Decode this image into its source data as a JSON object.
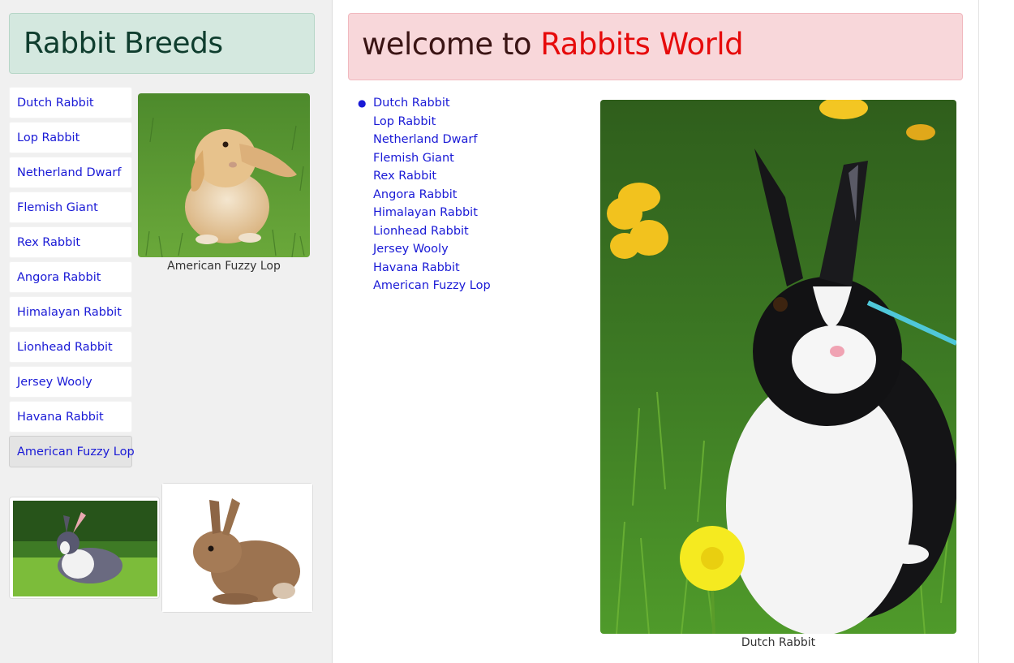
{
  "sidebar": {
    "title": "Rabbit Breeds",
    "items": [
      {
        "label": "Dutch Rabbit"
      },
      {
        "label": "Lop Rabbit"
      },
      {
        "label": "Netherland Dwarf"
      },
      {
        "label": "Flemish Giant"
      },
      {
        "label": "Rex Rabbit"
      },
      {
        "label": "Angora Rabbit"
      },
      {
        "label": "Himalayan Rabbit"
      },
      {
        "label": "Lionhead Rabbit"
      },
      {
        "label": "Jersey Wooly"
      },
      {
        "label": "Havana Rabbit"
      },
      {
        "label": "American Fuzzy Lop"
      }
    ],
    "active_item": "American Fuzzy Lop",
    "figure_caption": "American Fuzzy Lop"
  },
  "main": {
    "heading_prefix": "welcome to ",
    "heading_accent": "Rabbits World",
    "links": [
      {
        "label": "Dutch Rabbit"
      },
      {
        "label": "Lop Rabbit"
      },
      {
        "label": "Netherland Dwarf"
      },
      {
        "label": "Flemish Giant"
      },
      {
        "label": "Rex Rabbit"
      },
      {
        "label": "Angora Rabbit"
      },
      {
        "label": "Himalayan Rabbit"
      },
      {
        "label": "Lionhead Rabbit"
      },
      {
        "label": "Jersey Wooly"
      },
      {
        "label": "Havana Rabbit"
      },
      {
        "label": "American Fuzzy Lop"
      }
    ],
    "figure_caption": "Dutch Rabbit"
  },
  "colors": {
    "link": "#1a1ad6",
    "accent": "#e60b0b",
    "sidebar_header_bg": "#d4e8df",
    "main_header_bg": "#f8d7da"
  }
}
